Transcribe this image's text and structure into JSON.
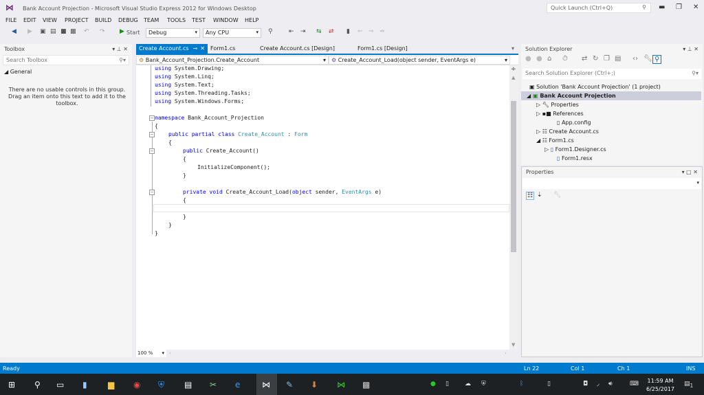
{
  "window": {
    "title": "Bank Account Projection - Microsoft Visual Studio Express 2012 for Windows Desktop",
    "quick_launch_placeholder": "Quick Launch (Ctrl+Q)"
  },
  "menu": [
    "FILE",
    "EDIT",
    "VIEW",
    "PROJECT",
    "BUILD",
    "DEBUG",
    "TEAM",
    "TOOLS",
    "TEST",
    "WINDOW",
    "HELP"
  ],
  "toolbar": {
    "start_label": "Start",
    "config": "Debug",
    "platform": "Any CPU"
  },
  "toolbox": {
    "title": "Toolbox",
    "search_placeholder": "Search Toolbox",
    "group": "General",
    "empty_message": "There are no usable controls in this group. Drag an item onto this text to add it to the toolbox."
  },
  "editor": {
    "tabs": [
      "Create Account.cs",
      "Form1.cs",
      "Create Account.cs [Design]",
      "Form1.cs [Design]"
    ],
    "nav_type": "Bank_Account_Projection.Create_Account",
    "nav_member": "Create_Account_Load(object sender, EventArgs e)",
    "zoom": "100 %",
    "lines": [
      [
        "using",
        " System.Drawing;"
      ],
      [
        "using",
        " System.Linq;"
      ],
      [
        "using",
        " System.Text;"
      ],
      [
        "using",
        " System.Threading.Tasks;"
      ],
      [
        "using",
        " System.Windows.Forms;"
      ]
    ],
    "ns_kw": "namespace",
    "ns_name": " Bank_Account_Projection",
    "class_kw": "public partial class",
    "class_name": "Create_Account",
    "class_sep": " : ",
    "class_base": "Form",
    "ctor_kw": "public",
    "ctor_name": " Create_Account()",
    "init_call": "InitializeComponent();",
    "method_kw": "private void",
    "method_name": " Create_Account_Load(",
    "obj_kw": "object",
    "method_mid": " sender, ",
    "evt_type": "EventArgs",
    "method_end": " e)",
    "open_brace": "{",
    "close_brace": "}"
  },
  "solution_explorer": {
    "title": "Solution Explorer",
    "search_placeholder": "Search Solution Explorer (Ctrl+;)",
    "items": [
      "Solution 'Bank Account Projection' (1 project)",
      "Bank Account Projection",
      "Properties",
      "References",
      "App.config",
      "Create Account.cs",
      "Form1.cs",
      "Form1.Designer.cs",
      "Form1.resx"
    ]
  },
  "properties": {
    "title": "Properties"
  },
  "status": {
    "text": "Ready",
    "line": "Ln 22",
    "col": "Col 1",
    "ch": "Ch 1",
    "mode": "INS"
  },
  "taskbar": {
    "time": "11:59 AM",
    "date": "6/25/2017",
    "notifications": "1"
  },
  "colors": {
    "accent": "#007acc",
    "keyword": "#0000ff",
    "type": "#2b91af"
  }
}
